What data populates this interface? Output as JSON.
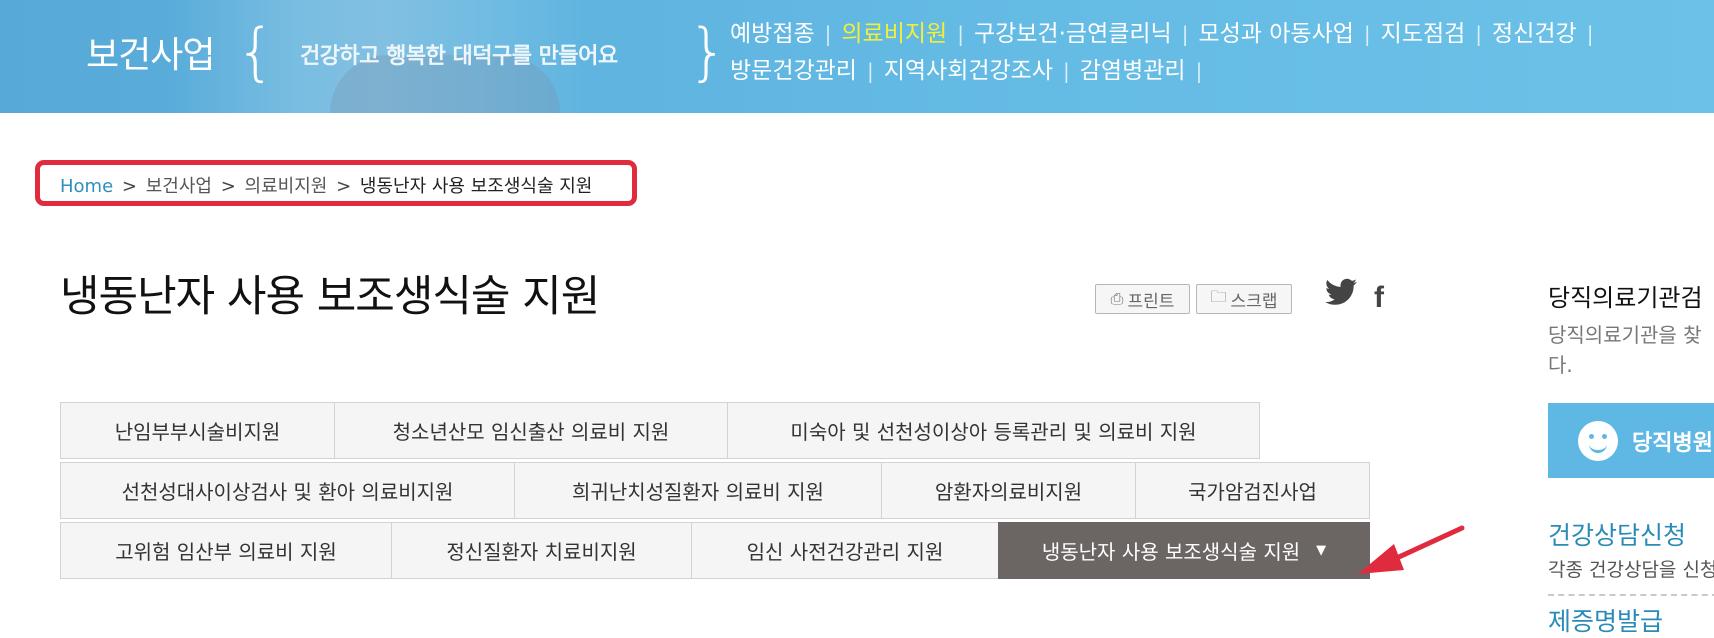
{
  "header": {
    "section_title": "보건사업",
    "slogan": "건강하고 행복한 대덕구를 만들어요",
    "brace_left": "{",
    "brace_right": "}",
    "nav_separator": "|",
    "nav_items": [
      {
        "label": "예방접종",
        "active": false
      },
      {
        "label": "의료비지원",
        "active": true
      },
      {
        "label": "구강보건·금연클리닉",
        "active": false
      },
      {
        "label": "모성과 아동사업",
        "active": false
      },
      {
        "label": "지도점검",
        "active": false
      },
      {
        "label": "정신건강",
        "active": false
      },
      {
        "label": "방문건강관리",
        "active": false
      },
      {
        "label": "지역사회건강조사",
        "active": false
      },
      {
        "label": "감염병관리",
        "active": false
      }
    ],
    "active_color": "#f2ef3a"
  },
  "breadcrumb": {
    "home": "Home",
    "separator": ">",
    "items": [
      "보건사업",
      "의료비지원"
    ],
    "current": "냉동난자 사용 보조생식술 지원",
    "highlight_color": "#e02a3e"
  },
  "page": {
    "title": "냉동난자 사용 보조생식술 지원"
  },
  "tools": {
    "print_label": "프린트",
    "scrap_label": "스크랩",
    "print_icon": "printer-icon",
    "scrap_icon": "folder-icon",
    "twitter_icon": "twitter-icon",
    "facebook_icon": "facebook-icon",
    "twitter_glyph": "🐦",
    "facebook_glyph": "f"
  },
  "tabs": {
    "row1": [
      "난임부부시술비지원",
      "청소년산모 임신출산 의료비 지원",
      "미숙아 및 선천성이상아 등록관리 및 의료비 지원"
    ],
    "row2": [
      "선천성대사이상검사 및 환아 의료비지원",
      "희귀난치성질환자 의료비 지원",
      "암환자의료비지원",
      "국가암검진사업"
    ],
    "row3": [
      "고위험 임산부 의료비 지원",
      "정신질환자 치료비지원",
      "임신 사전건강관리 지원",
      "냉동난자 사용 보조생식술 지원"
    ],
    "active": "냉동난자 사용 보조생식술 지원",
    "active_color": "#6b6663",
    "caret": "▼"
  },
  "sidebar": {
    "heading": "당직의료기관검",
    "description": "당직의료기관을 찾\n다.",
    "button_label": "당직병원",
    "link1": "건강상담신청",
    "link1_desc": "각종 건강상담을 신청",
    "link2": "제증명발급"
  }
}
